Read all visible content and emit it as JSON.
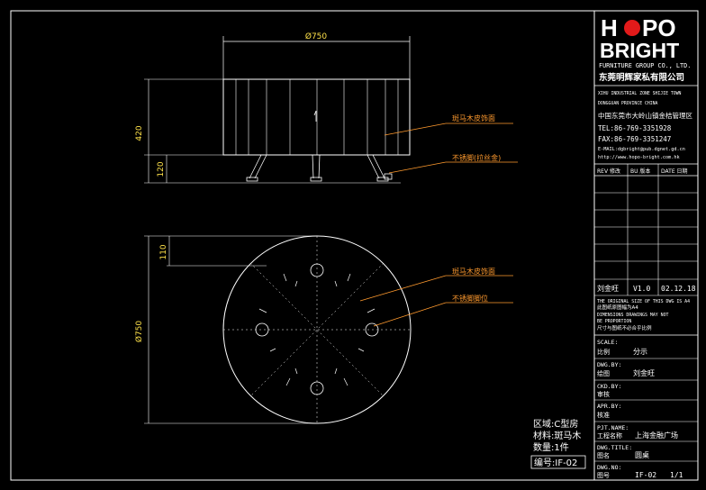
{
  "drawing": {
    "front_view": {
      "dim_width": "Ø750",
      "dim_height_total": "420",
      "dim_leg_height": "120",
      "callout_surface": "斑马木皮饰面",
      "callout_legs": "不锈脚(拉丝金)"
    },
    "top_view": {
      "dim_edge": "110",
      "dim_diameter": "Ø750",
      "callout_surface": "斑马木皮饰面",
      "callout_leg_pos": "不锈脚脚位"
    },
    "notes": {
      "area": "区域:C型房",
      "material": "材料:斑马木",
      "quantity": "数量:1件",
      "code": "编号:IF-02"
    }
  },
  "title_block": {
    "logo_line1_a": "H",
    "logo_line1_b": "PO",
    "logo_line2": "BRIGHT",
    "company_en": "FURNITURE GROUP CO., LTD.",
    "company_cn": "东莞明辉家私有限公司",
    "address_en_1": "XIHU INDUSTRIAL ZONE SHIJIE TOWN",
    "address_en_2": "DONGGUAN PROVINCE CHINA",
    "address_cn": "中国东莞市大岭山镇金桔管理区",
    "tel": "TEL:86-769-3351928",
    "fax": "FAX:86-769-3351247",
    "email": "E-MAIL:dgbright@pub.dgnet.gd.cn",
    "web": "http://www.hopo-bright.com.hk",
    "rev_headers": [
      "REV 修改",
      "BU 版本",
      "DATE 日期"
    ],
    "designer": "刘金旺",
    "version": "V1.0",
    "date": "02.12.18",
    "note_en_1": "THE ORIGINAL SIZE OF THIS DWG IS A4",
    "note_cn_1": "此图纸原图幅为A4",
    "note_en_2": "DIMENSIONS DRAWINGS MAY NOT",
    "note_en_3": "BE PROPORTION",
    "note_cn_2": "尺寸与图纸不必合乎比例",
    "scale_label": "SCALE:",
    "scale_cn": "比例",
    "scale_value": "分示",
    "drawn_label": "DWG.BY:",
    "drawn_cn": "绘图",
    "drawn_value": "刘金旺",
    "checked_label": "CKD.BY:",
    "checked_cn": "审核",
    "approved_label": "APR.BY:",
    "approved_cn": "核准",
    "project_label": "PJT.NAME:",
    "project_cn": "工程名称",
    "project_value": "上海金融广场",
    "title_label": "DWG.TITLE:",
    "title_cn": "图名",
    "title_value": "圆桌",
    "number_label": "DWG.NO:",
    "number_cn": "图号",
    "number_value": "IF-02",
    "sheet_value": "1/1"
  }
}
